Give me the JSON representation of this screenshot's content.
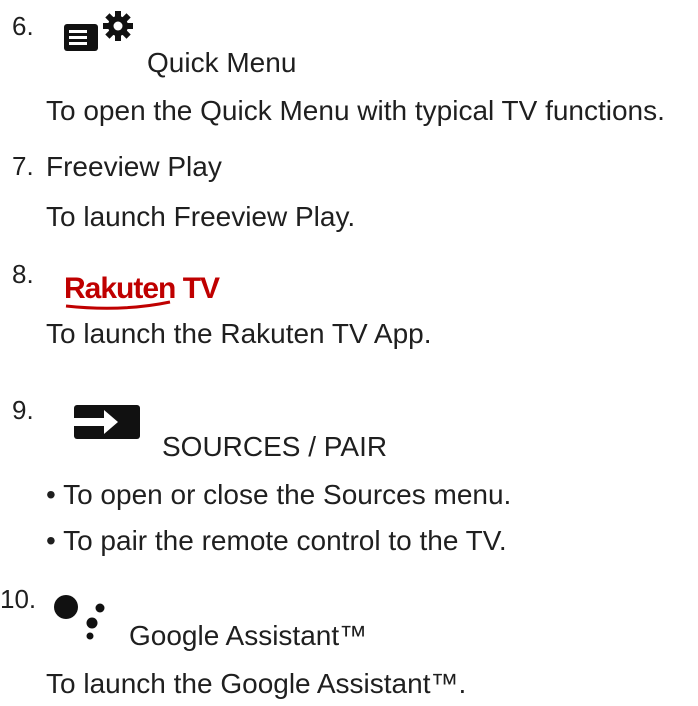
{
  "items": [
    {
      "number": "6.",
      "icon": "quick-menu-icon",
      "label": "Quick Menu",
      "lines": [
        "To open the Quick Menu with typical TV functions."
      ]
    },
    {
      "number": "7.",
      "label": "Freeview Play",
      "lines": [
        "To launch Freeview Play."
      ]
    },
    {
      "number": "8.",
      "icon": "rakuten-tv-logo",
      "logo_text": "Rakuten TV",
      "lines": [
        "To launch the Rakuten TV App."
      ]
    },
    {
      "number": "9.",
      "icon": "sources-icon",
      "label": "SOURCES / PAIR",
      "bullets": [
        "• To open or close the Sources menu.",
        "• To pair the remote control to the TV."
      ]
    },
    {
      "number": "10.",
      "icon": "google-assistant-icon",
      "label": "Google Assistant™",
      "lines": [
        "To launch the Google Assistant™."
      ]
    }
  ],
  "colors": {
    "text": "#1f1f1f",
    "icon": "#111111",
    "rakuten": "#bf0000"
  }
}
